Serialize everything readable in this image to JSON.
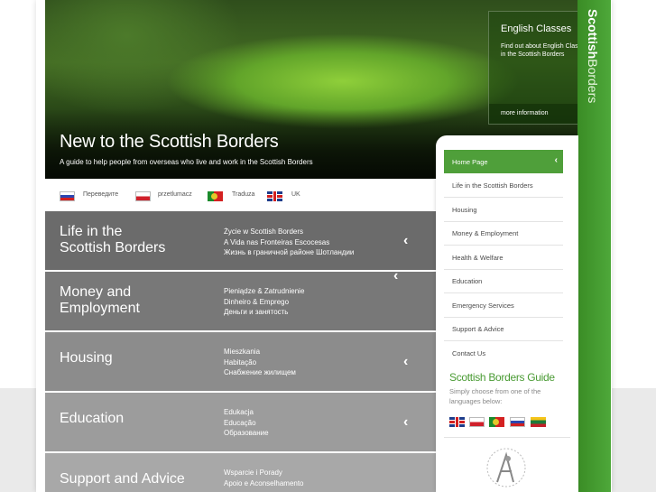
{
  "brand": {
    "bold": "Scottish",
    "light": "Borders"
  },
  "hero": {
    "title": "New to the Scottish Borders",
    "subtitle": "A guide to help people from overseas who live and work in the Scottish Borders"
  },
  "english_box": {
    "title": "English Classes",
    "text": "Find out about English Classes in the Scottish Borders",
    "more": "more information"
  },
  "lang_bar": [
    {
      "flag": "ru",
      "label": "Переведите"
    },
    {
      "flag": "pl",
      "label": "przetlumacz"
    },
    {
      "flag": "pt",
      "label": "Traduza"
    },
    {
      "flag": "uk",
      "label": "UK"
    }
  ],
  "panels": [
    {
      "heading": [
        "Life in the",
        "Scottish Borders"
      ],
      "translations": [
        "Życie w Scottish Borders",
        "A Vida nas Fronteiras Escocesas",
        "Жизнь в граничной районе Шотландии"
      ],
      "color": "#6b6b6b"
    },
    {
      "heading": [
        "Money and",
        "Employment"
      ],
      "translations": [
        "Pieniądze & Zatrudnienie",
        "Dinheiro & Emprego",
        "Деньги и занятость"
      ],
      "color": "#787878"
    },
    {
      "heading": [
        "Housing"
      ],
      "translations": [
        "Mieszkania",
        "Habitação",
        "Снабжение жилищем"
      ],
      "color": "#8c8c8c"
    },
    {
      "heading": [
        "Education"
      ],
      "translations": [
        "Edukacja",
        "Educação",
        "Образование"
      ],
      "color": "#9c9c9c"
    },
    {
      "heading": [
        "Support and Advice"
      ],
      "translations": [
        "Wsparcie i Porady",
        "Apoio e Aconselhamento"
      ],
      "color": "#a8a8a8"
    }
  ],
  "nav": [
    "Home Page",
    "Life in the Scottish Borders",
    "Housing",
    "Money & Employment",
    "Health & Welfare",
    "Education",
    "Emergency Services",
    "Support & Advice",
    "Contact Us"
  ],
  "guide": {
    "title": "Scottish Borders Guide",
    "text": "Simply choose from one of the languages below:",
    "flags": [
      "uk",
      "pl",
      "pt",
      "ru",
      "lt"
    ]
  },
  "icons": {
    "chevron": "‹"
  },
  "colors": {
    "green": "#4f9f3a",
    "title_green": "#4a9b34"
  }
}
